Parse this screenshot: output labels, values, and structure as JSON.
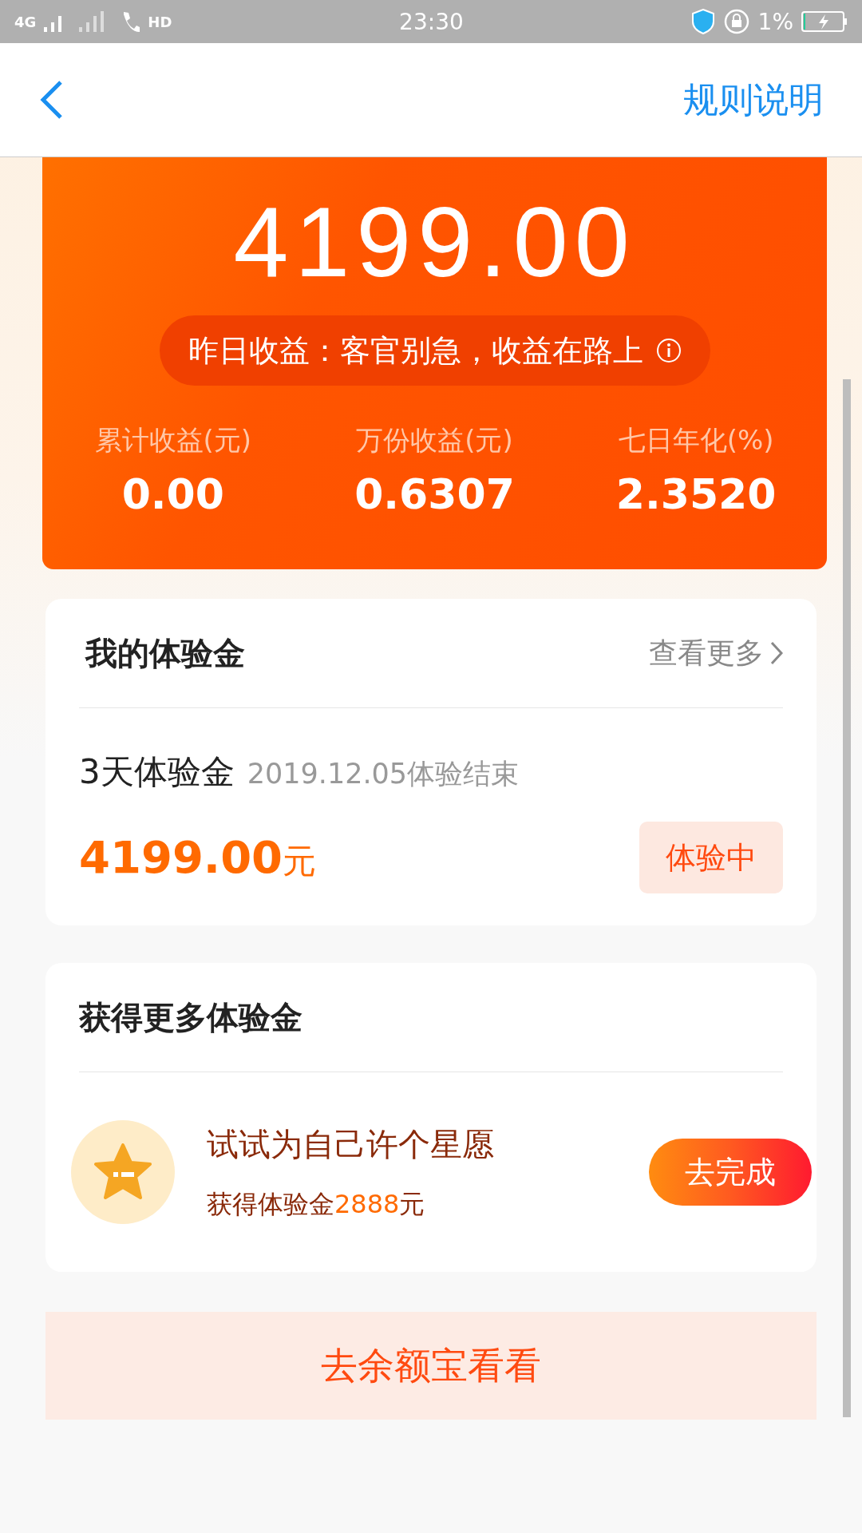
{
  "status_bar": {
    "network": "4G",
    "hd": "HD",
    "time": "23:30",
    "battery": "1%"
  },
  "header": {
    "action": "规则说明"
  },
  "summary": {
    "amount": "4199.00",
    "notice": "昨日收益：客官别急，收益在路上",
    "stats": [
      {
        "label": "累计收益(元)",
        "value": "0.00"
      },
      {
        "label": "万份收益(元)",
        "value": "0.6307"
      },
      {
        "label": "七日年化(%)",
        "value": "2.3520"
      }
    ]
  },
  "my_trial": {
    "title": "我的体验金",
    "more": "查看更多",
    "item": {
      "name": "3天体验金",
      "end": "2019.12.05体验结束",
      "amount": "4199.00",
      "unit": "元",
      "status": "体验中"
    }
  },
  "more_trial": {
    "title": "获得更多体验金",
    "tasks": [
      {
        "title": "试试为自己许个星愿",
        "reward": "获得体验金**2888**元",
        "action": "去完成"
      }
    ]
  },
  "banner": "去余额宝看看"
}
